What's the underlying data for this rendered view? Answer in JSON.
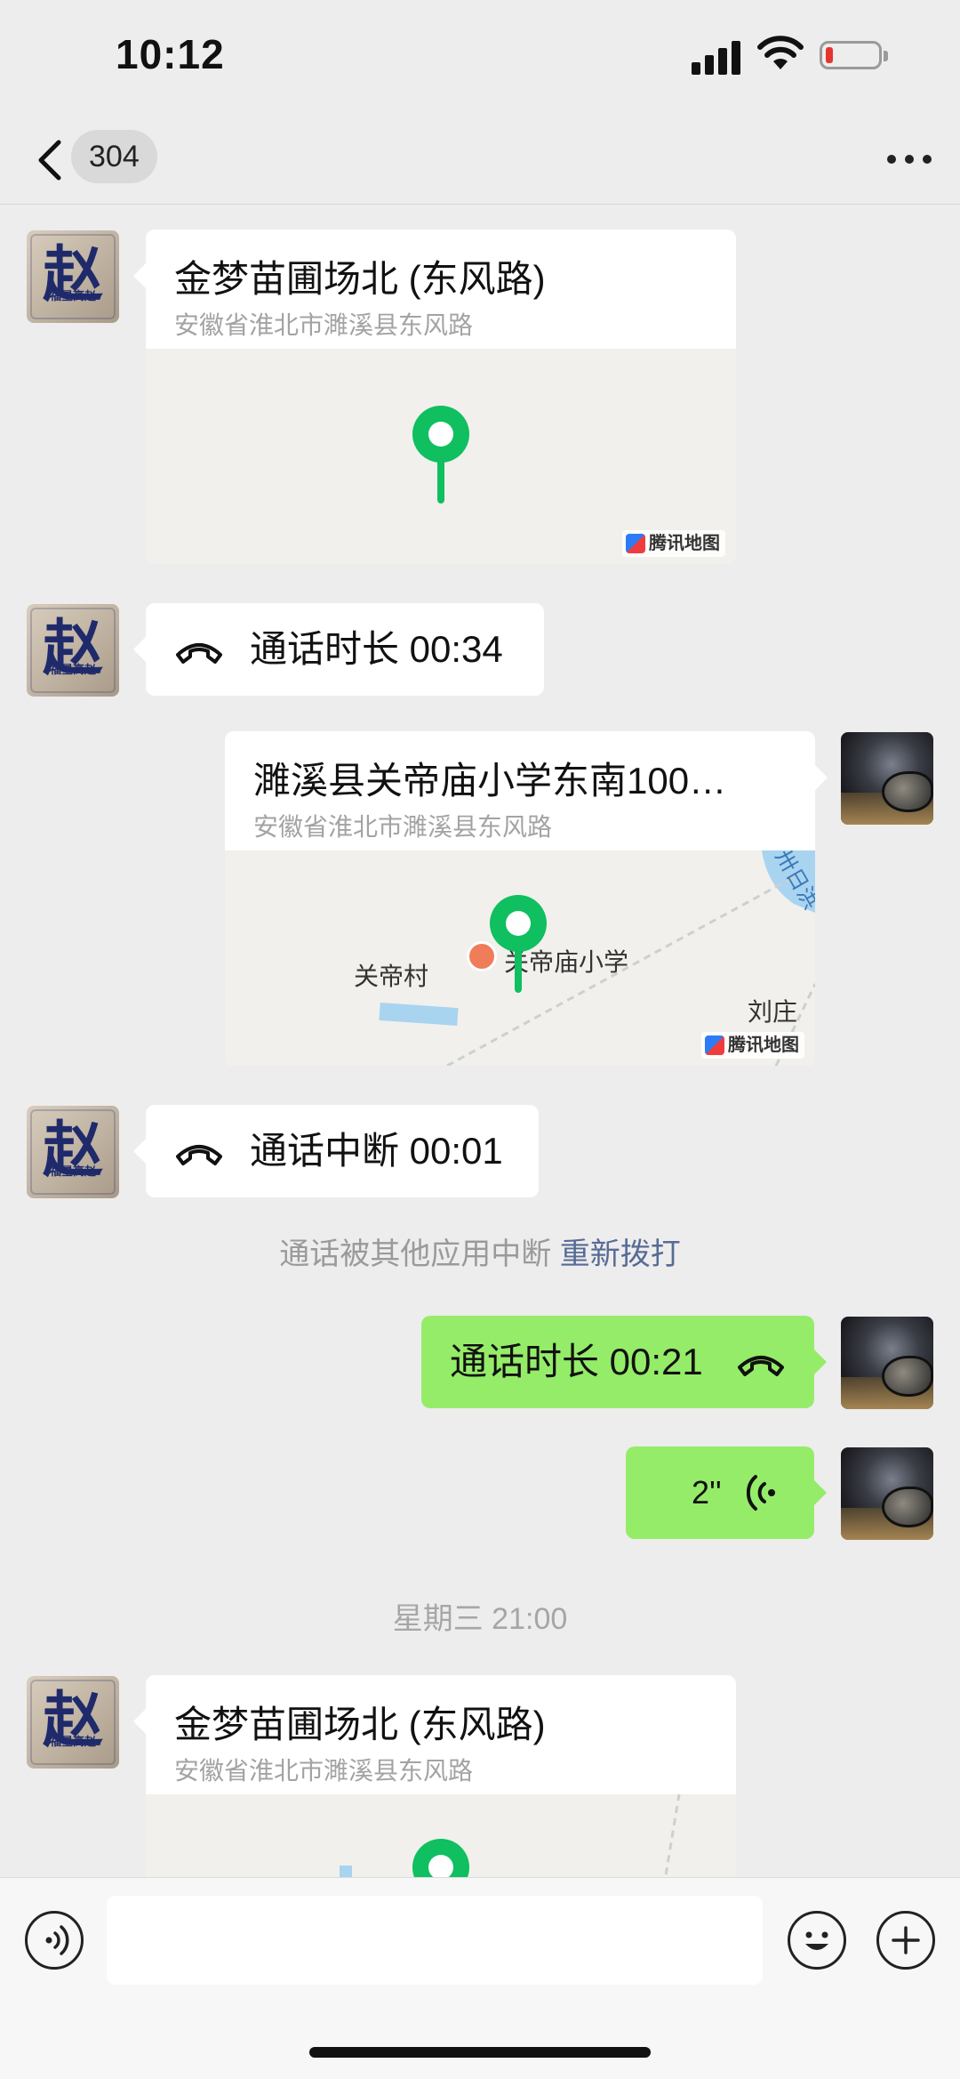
{
  "status": {
    "time": "10:12"
  },
  "nav": {
    "unread_count": "304"
  },
  "messages": {
    "loc1": {
      "title": "金梦苗圃场北 (东风路)",
      "address": "安徽省淮北市濉溪县东风路",
      "provider": "腾讯地图"
    },
    "call1": {
      "text": "通话时长 00:34"
    },
    "loc2": {
      "title": "濉溪县关帝庙小学东南100…",
      "address": "安徽省淮北市濉溪县东风路",
      "provider": "腾讯地图",
      "map_labels": {
        "village": "关帝村",
        "school": "关帝庙小学",
        "village2": "刘庄",
        "river": "卅日洪"
      }
    },
    "call2": {
      "text": "通话中断 00:01"
    },
    "notice": {
      "text": "通话被其他应用中断",
      "link": "重新拨打"
    },
    "call3": {
      "text": "通话时长 00:21"
    },
    "voice1": {
      "duration": "2''"
    },
    "timestamp": "星期三 21:00",
    "loc3": {
      "title": "金梦苗圃场北 (东风路)",
      "address": "安徽省淮北市濉溪县东风路"
    }
  },
  "avatar_zhao": {
    "glyph": "赵",
    "caption": "福星高赵"
  },
  "input": {
    "placeholder": ""
  },
  "colors": {
    "self_bubble": "#95ec69",
    "pin": "#0fbf60",
    "link": "#576b95",
    "background": "#ededed"
  },
  "icons": [
    "back-icon",
    "more-icon",
    "phone-icon",
    "voice-wave-icon",
    "voice-input-icon",
    "emoji-icon",
    "plus-icon"
  ]
}
